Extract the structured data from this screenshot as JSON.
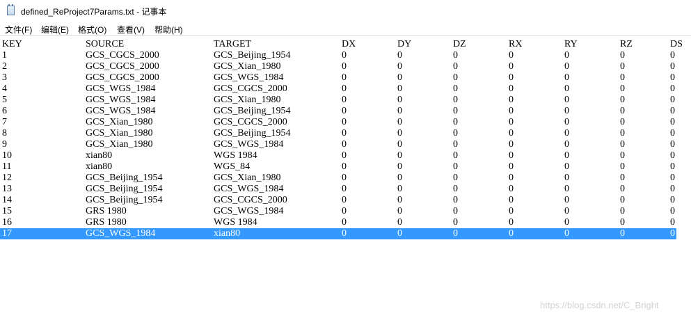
{
  "window": {
    "title": "defined_ReProject7Params.txt - 记事本"
  },
  "menu": {
    "file": "文件(F)",
    "edit": "编辑(E)",
    "format": "格式(O)",
    "view": "查看(V)",
    "help": "帮助(H)"
  },
  "header": [
    "KEY",
    "SOURCE",
    "TARGET",
    "DX",
    "DY",
    "DZ",
    "RX",
    "RY",
    "RZ",
    "DS"
  ],
  "rows": [
    [
      "1",
      "GCS_CGCS_2000",
      "GCS_Beijing_1954",
      "0",
      "0",
      "0",
      "0",
      "0",
      "0",
      "0"
    ],
    [
      "2",
      "GCS_CGCS_2000",
      "GCS_Xian_1980",
      "0",
      "0",
      "0",
      "0",
      "0",
      "0",
      "0"
    ],
    [
      "3",
      "GCS_CGCS_2000",
      "GCS_WGS_1984",
      "0",
      "0",
      "0",
      "0",
      "0",
      "0",
      "0"
    ],
    [
      "4",
      "GCS_WGS_1984",
      "GCS_CGCS_2000",
      "0",
      "0",
      "0",
      "0",
      "0",
      "0",
      "0"
    ],
    [
      "5",
      "GCS_WGS_1984",
      "GCS_Xian_1980",
      "0",
      "0",
      "0",
      "0",
      "0",
      "0",
      "0"
    ],
    [
      "6",
      "GCS_WGS_1984",
      "GCS_Beijing_1954",
      "0",
      "0",
      "0",
      "0",
      "0",
      "0",
      "0"
    ],
    [
      "7",
      "GCS_Xian_1980",
      "GCS_CGCS_2000",
      "0",
      "0",
      "0",
      "0",
      "0",
      "0",
      "0"
    ],
    [
      "8",
      "GCS_Xian_1980",
      "GCS_Beijing_1954",
      "0",
      "0",
      "0",
      "0",
      "0",
      "0",
      "0"
    ],
    [
      "9",
      "GCS_Xian_1980",
      "GCS_WGS_1984",
      "0",
      "0",
      "0",
      "0",
      "0",
      "0",
      "0"
    ],
    [
      "10",
      "xian80",
      "WGS 1984",
      "0",
      "0",
      "0",
      "0",
      "0",
      "0",
      "0"
    ],
    [
      "11",
      "xian80",
      "WGS_84",
      "0",
      "0",
      "0",
      "0",
      "0",
      "0",
      "0"
    ],
    [
      "12",
      "GCS_Beijing_1954",
      "GCS_Xian_1980",
      "0",
      "0",
      "0",
      "0",
      "0",
      "0",
      "0"
    ],
    [
      "13",
      "GCS_Beijing_1954",
      "GCS_WGS_1984",
      "0",
      "0",
      "0",
      "0",
      "0",
      "0",
      "0"
    ],
    [
      "14",
      "GCS_Beijing_1954",
      "GCS_CGCS_2000",
      "0",
      "0",
      "0",
      "0",
      "0",
      "0",
      "0"
    ],
    [
      "15",
      "GRS 1980",
      "GCS_WGS_1984",
      "0",
      "0",
      "0",
      "0",
      "0",
      "0",
      "0"
    ],
    [
      "16",
      "GRS 1980",
      "WGS 1984",
      "0",
      "0",
      "0",
      "0",
      "0",
      "0",
      "0"
    ],
    [
      "17",
      "GCS_WGS_1984",
      "xian80",
      "0",
      "0",
      "0",
      "0",
      "0",
      "0",
      "0"
    ]
  ],
  "selected_row": 17,
  "watermark": "https://blog.csdn.net/C_Bright",
  "colors": {
    "selection": "#3399ff",
    "text": "#000000",
    "background": "#ffffff"
  },
  "icons": {
    "app": "notepad-icon"
  }
}
